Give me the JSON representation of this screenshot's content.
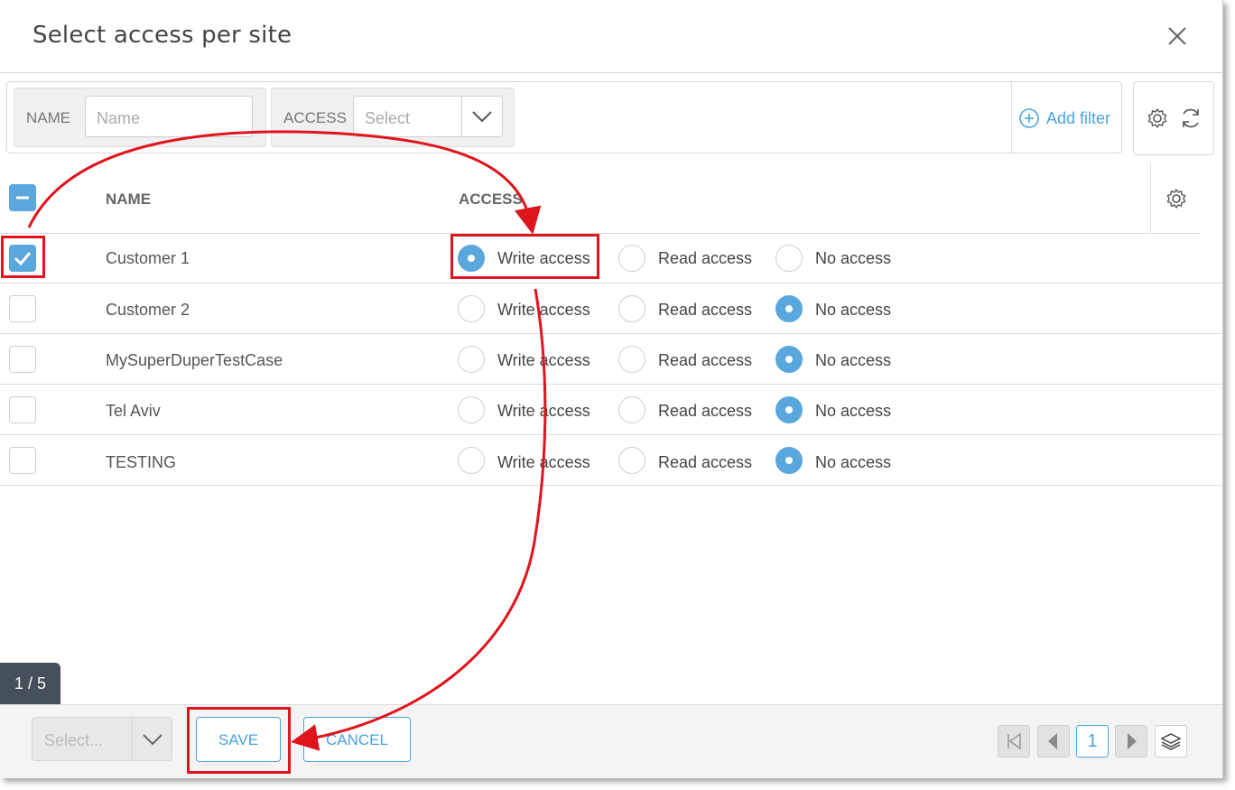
{
  "dialog": {
    "title": "Select access per site"
  },
  "filters": {
    "name_label": "NAME",
    "name_placeholder": "Name",
    "access_label": "ACCESS",
    "access_placeholder": "Select",
    "add_filter_label": "Add filter"
  },
  "table": {
    "columns": [
      "NAME",
      "ACCESS"
    ],
    "options": [
      "Write access",
      "Read access",
      "No access"
    ],
    "rows": [
      {
        "name": "Customer 1",
        "checked": true,
        "access": "Write access"
      },
      {
        "name": "Customer 2",
        "checked": false,
        "access": "No access"
      },
      {
        "name": "MySuperDuperTestCase",
        "checked": false,
        "access": "No access"
      },
      {
        "name": "Tel Aviv",
        "checked": false,
        "access": "No access"
      },
      {
        "name": "TESTING",
        "checked": false,
        "access": "No access"
      }
    ]
  },
  "footer": {
    "counter": "1 / 5",
    "select_placeholder": "Select...",
    "save_label": "SAVE",
    "cancel_label": "CANCEL",
    "current_page": "1"
  },
  "colors": {
    "accent": "#4aa3df",
    "selected": "#5aa7de",
    "annotation": "#e0141c",
    "counter_bg": "#45505a"
  }
}
